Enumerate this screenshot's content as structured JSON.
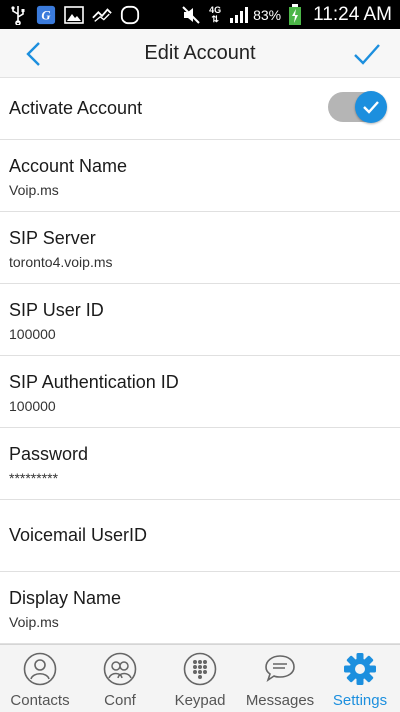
{
  "status_bar": {
    "network": "4G",
    "battery_percent": "83%",
    "time": "11:24 AM",
    "icons": [
      "usb-icon",
      "app-icon",
      "image-icon",
      "signal-icon",
      "circle-icon",
      "mute-icon",
      "network-icon",
      "signal-bars-icon",
      "battery-charging-icon"
    ]
  },
  "header": {
    "title": "Edit Account",
    "back_icon": "chevron-left-icon",
    "done_icon": "checkmark-icon"
  },
  "activate": {
    "label": "Activate Account",
    "enabled": true
  },
  "fields": [
    {
      "label": "Account Name",
      "value": "Voip.ms"
    },
    {
      "label": "SIP Server",
      "value": "toronto4.voip.ms"
    },
    {
      "label": "SIP User ID",
      "value": "100000"
    },
    {
      "label": "SIP Authentication ID",
      "value": "100000"
    },
    {
      "label": "Password",
      "value": "*********"
    },
    {
      "label": "Voicemail UserID",
      "value": ""
    },
    {
      "label": "Display Name",
      "value": "Voip.ms"
    }
  ],
  "tabs": [
    {
      "label": "Contacts",
      "icon": "contact-icon",
      "active": false
    },
    {
      "label": "Conf",
      "icon": "conference-icon",
      "active": false
    },
    {
      "label": "Keypad",
      "icon": "keypad-icon",
      "active": false
    },
    {
      "label": "Messages",
      "icon": "chat-icon",
      "active": false
    },
    {
      "label": "Settings",
      "icon": "gear-icon",
      "active": true
    }
  ],
  "colors": {
    "accent": "#1c8fde",
    "toggle_track": "#b5b5b5",
    "divider": "#e0e0e0"
  }
}
